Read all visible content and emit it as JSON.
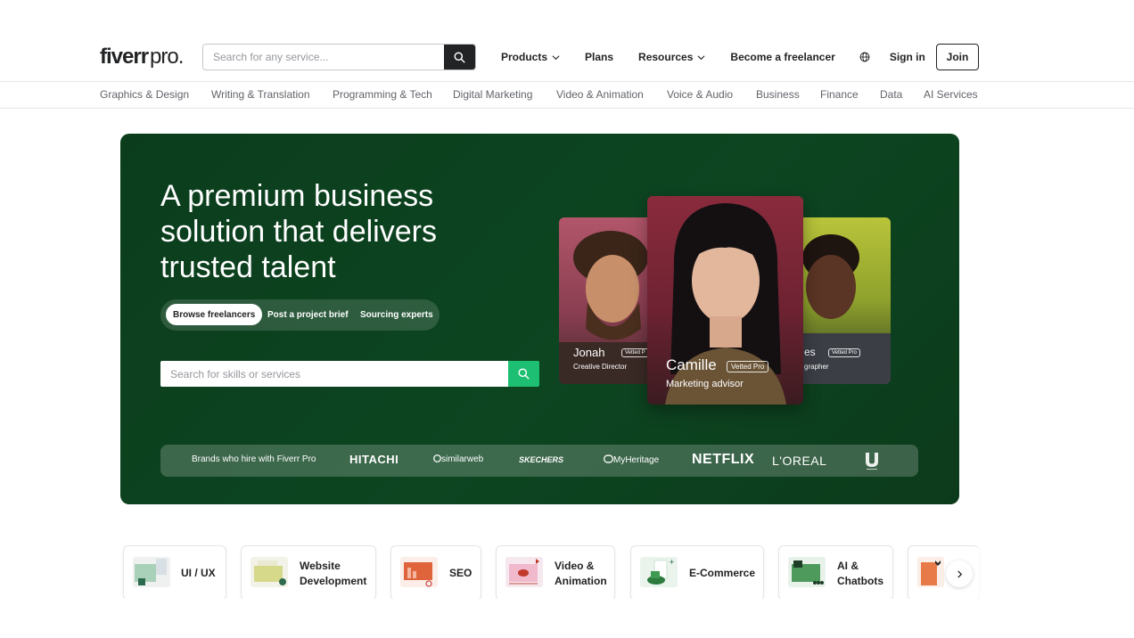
{
  "header": {
    "logo_main": "fiverr",
    "logo_suffix": "pro.",
    "search_placeholder": "Search for any service...",
    "nav": {
      "products": "Products",
      "plans": "Plans",
      "resources": "Resources",
      "become_freelancer": "Become a freelancer",
      "sign_in": "Sign in",
      "join": "Join"
    }
  },
  "categories": [
    "Graphics & Design",
    "Writing & Translation",
    "Programming & Tech",
    "Digital Marketing",
    "Video & Animation",
    "Voice & Audio",
    "Business",
    "Finance",
    "Data",
    "AI Services"
  ],
  "hero": {
    "title": "A premium business solution that delivers trusted talent",
    "tabs": [
      "Browse freelancers",
      "Post a project brief",
      "Sourcing experts"
    ],
    "search_placeholder": "Search for skills or services",
    "brands_label": "Brands who hire with Fiverr Pro",
    "brands": [
      "HITACHI",
      "similarweb",
      "SKECHERS",
      "MyHeritage",
      "NETFLIX",
      "L'OREAL"
    ],
    "cards": {
      "left": {
        "name": "Jonah",
        "badge": "Vetted P",
        "role": "Creative Director"
      },
      "center": {
        "name": "Camille",
        "badge": "Vetted Pro",
        "role": "Marketing advisor"
      },
      "right": {
        "name": "es",
        "badge": "Vetted Pro",
        "role": "grapher"
      }
    }
  },
  "tiles": [
    {
      "line1": "UI / UX",
      "line2": ""
    },
    {
      "line1": "Website",
      "line2": "Development"
    },
    {
      "line1": "SEO",
      "line2": ""
    },
    {
      "line1": "Video &",
      "line2": "Animation"
    },
    {
      "line1": "E-Commerce",
      "line2": ""
    },
    {
      "line1": "AI &",
      "line2": "Chatbots"
    }
  ],
  "colors": {
    "hero_bg": "#0d4521",
    "accent_green": "#1dbf73",
    "text_dark": "#222325"
  }
}
